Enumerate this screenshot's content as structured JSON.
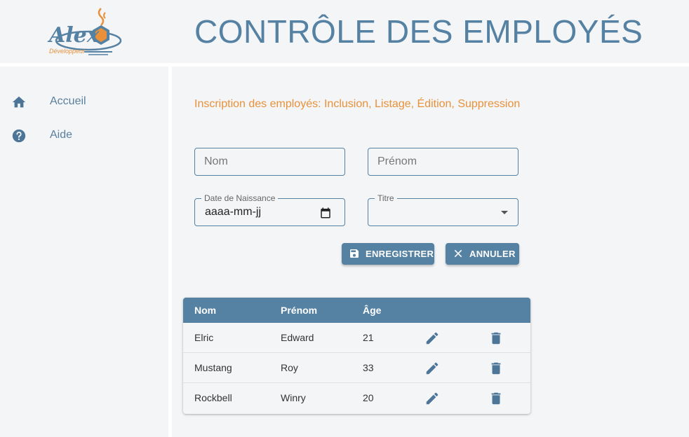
{
  "header": {
    "logo_text": "Alex",
    "logo_subtext": "Développeur",
    "title": "CONTRÔLE DES EMPLOYÉS"
  },
  "sidebar": {
    "items": [
      {
        "label": "Accueil",
        "icon": "home-icon"
      },
      {
        "label": "Aide",
        "icon": "help-icon"
      }
    ]
  },
  "main": {
    "subtitle": "Inscription des employés: Inclusion, Listage, Édition, Suppression",
    "form": {
      "nom_placeholder": "Nom",
      "prenom_placeholder": "Prénom",
      "date_label": "Date de Naissance",
      "date_value": "aaaa-mm-jj",
      "titre_label": "Titre",
      "titre_value": ""
    },
    "buttons": {
      "save": "ENREGISTRER",
      "cancel": "ANNULER"
    },
    "table": {
      "headers": [
        "Nom",
        "Prénom",
        "Âge"
      ],
      "rows": [
        {
          "nom": "Elric",
          "prenom": "Edward",
          "age": "21"
        },
        {
          "nom": "Mustang",
          "prenom": "Roy",
          "age": "33"
        },
        {
          "nom": "Rockbell",
          "prenom": "Winry",
          "age": "20"
        }
      ]
    }
  },
  "colors": {
    "primary": "#5581a3",
    "accent": "#e8913a",
    "background": "#f4f5f7"
  }
}
